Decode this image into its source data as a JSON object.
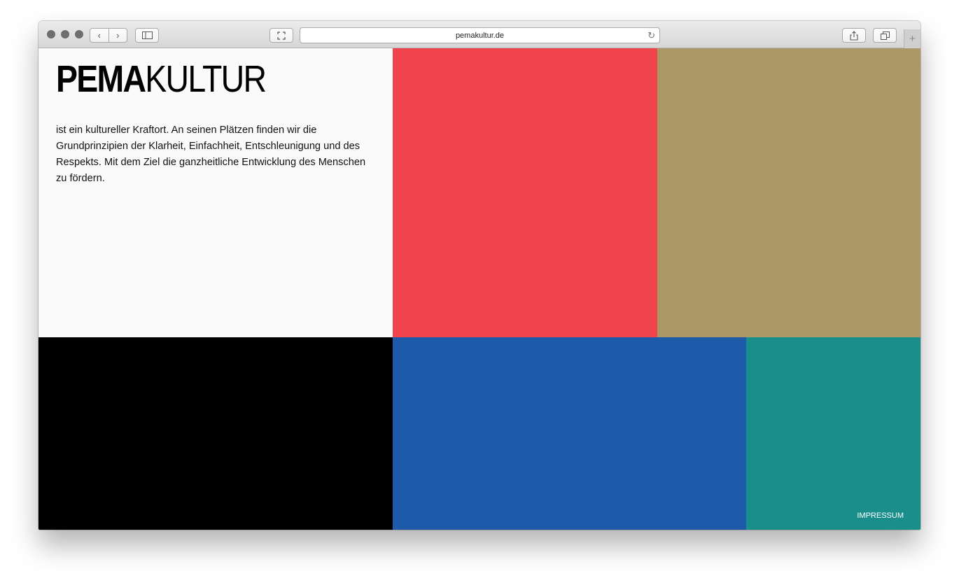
{
  "browser": {
    "url": "pemakultur.de",
    "reload_icon": "reload-icon",
    "new_tab_label": "+"
  },
  "site": {
    "logo_bold": "PEMA",
    "logo_light": "KULTUR",
    "description": "ist ein kultureller Kraftort. An seinen Plätzen finden wir die Grundprinzipien der Klarheit, Einfachheit, Entschleunigung und des Respekts. Mit dem Ziel die ganzheitliche Entwicklung des Menschen zu fördern.",
    "impressum_label": "IMPRESSUM"
  },
  "colors": {
    "red": "#f1434c",
    "gold": "#ac9867",
    "black": "#000000",
    "blue": "#1d5aa9",
    "teal": "#1a8e8b"
  }
}
